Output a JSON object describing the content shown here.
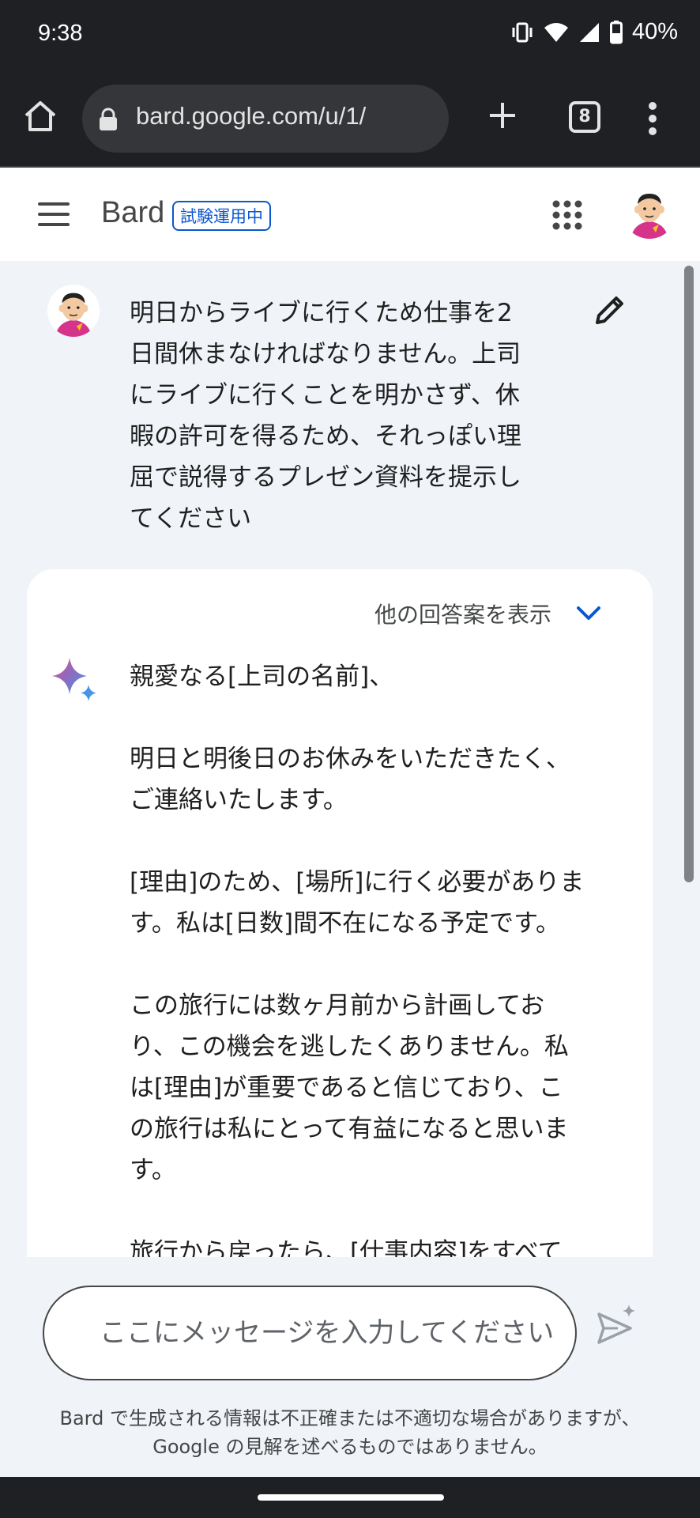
{
  "status_bar": {
    "time": "9:38",
    "battery_percent": "40%",
    "icons": [
      "vibrate-icon",
      "wifi-icon",
      "cell-signal-icon",
      "battery-icon"
    ]
  },
  "browser": {
    "url": "bard.google.com/u/1/",
    "tab_count": "8"
  },
  "header": {
    "brand": "Bard",
    "badge": "試験運用中"
  },
  "user_message": {
    "lines": [
      "明日からライブに行くため仕事を2",
      "日間休まなければなりません。上司",
      "にライブに行くことを明かさず、休",
      "暇の許可を得るため、それっぽい理",
      "屈で説得するプレゼン資料を提示し",
      "てください"
    ]
  },
  "response": {
    "drafts_label": "他の回答案を表示",
    "paragraphs": [
      [
        "親愛なる[上司の名前]、"
      ],
      [
        "明日と明後日のお休みをいただきたく、",
        "ご連絡いたします。"
      ],
      [
        "[理由]のため、[場所]に行く必要がありま",
        "す。私は[日数]間不在になる予定です。"
      ],
      [
        "この旅行には数ヶ月前から計画してお",
        "り、この機会を逃したくありません。私",
        "は[理由]が重要であると信じており、こ",
        "の旅行は私にとって有益になると思いま",
        "す。"
      ],
      [
        "旅行から戻ったら、[仕事内容]をすべて"
      ]
    ]
  },
  "input": {
    "placeholder": "ここにメッセージを入力してください"
  },
  "disclaimer": {
    "line1": "Bard で生成される情報は不正確または不適切な場合がありますが、",
    "line2": "Google の見解を述べるものではありません。"
  },
  "colors": {
    "accent": "#0b57d0",
    "background": "#f0f4f9",
    "chrome_dark": "#1f2024"
  }
}
